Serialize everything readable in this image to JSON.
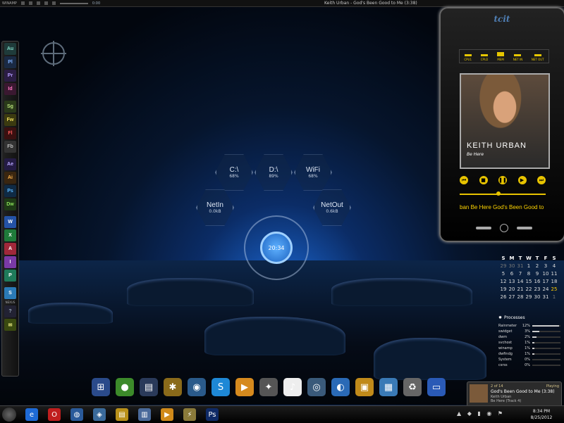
{
  "topbar": {
    "app_label": "WINAMP",
    "time": "0:00",
    "track": "Keith Urban - God's Been Good to Me (3:38)"
  },
  "left_dock": {
    "items": [
      {
        "label": "Au",
        "color": "#1f3b3a",
        "fg": "#7fd7c4",
        "icon": "audition-icon"
      },
      {
        "label": "Pl",
        "color": "#1a2a44",
        "fg": "#7fb0ff",
        "icon": "prelude-icon"
      },
      {
        "label": "Pr",
        "color": "#2b1d44",
        "fg": "#b59cff",
        "icon": "premiere-icon"
      },
      {
        "label": "Id",
        "color": "#3a1830",
        "fg": "#ff78c4",
        "icon": "indesign-icon"
      },
      {
        "label": "Sg",
        "color": "#2a3a1a",
        "fg": "#b7e07a",
        "icon": "speedgrade-icon"
      },
      {
        "label": "Fw",
        "color": "#3b3a10",
        "fg": "#f0de5a",
        "icon": "fireworks-icon"
      },
      {
        "label": "Fl",
        "color": "#3a1010",
        "fg": "#ff5a5a",
        "icon": "flash-icon"
      },
      {
        "label": "Fb",
        "color": "#333",
        "fg": "#bbb",
        "icon": "flash-builder-icon"
      },
      {
        "label": "Ae",
        "color": "#241b44",
        "fg": "#b8a6ff",
        "icon": "after-effects-icon"
      },
      {
        "label": "Ai",
        "color": "#3a2610",
        "fg": "#ffb24a",
        "icon": "illustrator-icon"
      },
      {
        "label": "Ps",
        "color": "#0f2a44",
        "fg": "#5ab8ff",
        "icon": "photoshop-icon"
      },
      {
        "label": "Dw",
        "color": "#1e3a16",
        "fg": "#8adf5a",
        "icon": "dreamweaver-icon"
      },
      {
        "label": "W",
        "color": "#2452a6",
        "fg": "#fff",
        "icon": "word-icon"
      },
      {
        "label": "X",
        "color": "#1f7a3a",
        "fg": "#fff",
        "icon": "excel-icon"
      },
      {
        "label": "A",
        "color": "#a0283a",
        "fg": "#fff",
        "icon": "access-icon"
      },
      {
        "label": "I",
        "color": "#7a3aa6",
        "fg": "#fff",
        "icon": "infopath-icon"
      },
      {
        "label": "P",
        "color": "#1f7a5a",
        "fg": "#fff",
        "icon": "publisher-icon"
      },
      {
        "label": "S",
        "color": "#2a7ab6",
        "fg": "#fff",
        "icon": "skype-icon"
      },
      {
        "label": "?",
        "color": "#223",
        "fg": "#9ab",
        "icon": "help-icon"
      },
      {
        "label": "✉",
        "color": "#3a4a10",
        "fg": "#dfe07a",
        "icon": "mail-icon"
      }
    ],
    "label_under_skype": "NEXUS"
  },
  "meters": [
    {
      "name": "C:\\",
      "value": "68%",
      "key": "drive-c"
    },
    {
      "name": "D:\\",
      "value": "89%",
      "key": "drive-d"
    },
    {
      "name": "WiFi",
      "value": "68%",
      "key": "wifi"
    },
    {
      "name": "NetIn",
      "value": "0.0kB",
      "key": "net-in"
    },
    {
      "name": "NetOut",
      "value": "0.6kB",
      "key": "net-out"
    }
  ],
  "clock": {
    "time": "20:34"
  },
  "phone": {
    "logo": "tcit",
    "meters": [
      "CPU1",
      "CPU2",
      "MEM",
      "NET IN",
      "NET OUT"
    ],
    "album_artist": "KEITH URBAN",
    "album_title": "Be Here",
    "scroll_title": "ban Be Here    God's Been Good to Me Ke",
    "seek_fraction": 0.45
  },
  "calendar": {
    "header": [
      "S",
      "M",
      "T",
      "W",
      "T",
      "F",
      "S"
    ],
    "days": [
      "29",
      "30",
      "31",
      "1",
      "2",
      "3",
      "4",
      "5",
      "6",
      "7",
      "8",
      "9",
      "10",
      "11",
      "12",
      "13",
      "14",
      "15",
      "16",
      "17",
      "18",
      "19",
      "20",
      "21",
      "22",
      "23",
      "24",
      "25",
      "26",
      "27",
      "28",
      "29",
      "30",
      "31",
      "1"
    ],
    "today": "25"
  },
  "processes": {
    "title": "Processes",
    "rows": [
      {
        "name": "Rainmeter",
        "pct": "12%",
        "value": 12
      },
      {
        "name": "swidget",
        "pct": "3%",
        "value": 3
      },
      {
        "name": "dwm",
        "pct": "2%",
        "value": 2
      },
      {
        "name": "svchost",
        "pct": "1%",
        "value": 1
      },
      {
        "name": "winamp",
        "pct": "1%",
        "value": 1
      },
      {
        "name": "dwfindg",
        "pct": "1%",
        "value": 1
      },
      {
        "name": "System",
        "pct": "0%",
        "value": 0
      },
      {
        "name": "csrss",
        "pct": "0%",
        "value": 0
      }
    ]
  },
  "bottom_dock": [
    {
      "icon": "windows-flag-icon",
      "glyph": "⊞",
      "color": "#2a4a8a"
    },
    {
      "icon": "xbox-icon",
      "glyph": "●",
      "color": "#3c8a2a"
    },
    {
      "icon": "computer-icon",
      "glyph": "▤",
      "color": "#2a3a5a"
    },
    {
      "icon": "utilities-icon",
      "glyph": "✱",
      "color": "#8a6a1a"
    },
    {
      "icon": "network-icon",
      "glyph": "◉",
      "color": "#2a5a8a"
    },
    {
      "icon": "skype-icon",
      "glyph": "S",
      "color": "#1e88d6"
    },
    {
      "icon": "media-icon",
      "glyph": "▶",
      "color": "#d68a1e"
    },
    {
      "icon": "settings-icon",
      "glyph": "✦",
      "color": "#555"
    },
    {
      "icon": "itunes-icon",
      "glyph": "♪",
      "color": "#eee"
    },
    {
      "icon": "globe-icon",
      "glyph": "◎",
      "color": "#3a5a7a"
    },
    {
      "icon": "browser-icon",
      "glyph": "◐",
      "color": "#2a6ab6"
    },
    {
      "icon": "folder-icon",
      "glyph": "▣",
      "color": "#c08a1a"
    },
    {
      "icon": "gallery-icon",
      "glyph": "▦",
      "color": "#3a7ab6"
    },
    {
      "icon": "recycle-bin-icon",
      "glyph": "♻",
      "color": "#666"
    },
    {
      "icon": "monitor-icon",
      "glyph": "▭",
      "color": "#2a5ab6"
    }
  ],
  "toast": {
    "track_no": "2 of 14",
    "status": "Playing",
    "title": "God's Been Good to Me (3:38)",
    "artist": "Keith Urban",
    "album": "Be Here (Track 4)"
  },
  "taskbar": {
    "icons": [
      {
        "icon": "ie-icon",
        "glyph": "e",
        "color": "#1e6ad6"
      },
      {
        "icon": "opera-icon",
        "glyph": "O",
        "color": "#c01e1e"
      },
      {
        "icon": "globe-icon",
        "glyph": "◍",
        "color": "#2a5a9a"
      },
      {
        "icon": "network-icon",
        "glyph": "◈",
        "color": "#3a6a9a"
      },
      {
        "icon": "explorer-icon",
        "glyph": "▤",
        "color": "#b8901a"
      },
      {
        "icon": "notepad-icon",
        "glyph": "▥",
        "color": "#4a6a9a"
      },
      {
        "icon": "player-icon",
        "glyph": "▶",
        "color": "#d08a1a"
      },
      {
        "icon": "winamp-icon",
        "glyph": "⚡",
        "color": "#8a7a3a"
      },
      {
        "icon": "photoshop-icon",
        "glyph": "Ps",
        "color": "#0f2a66"
      }
    ],
    "tray": "▲ ◆ ▮ ◉ ⚑",
    "time": "8:34 PM",
    "date": "8/25/2012"
  }
}
